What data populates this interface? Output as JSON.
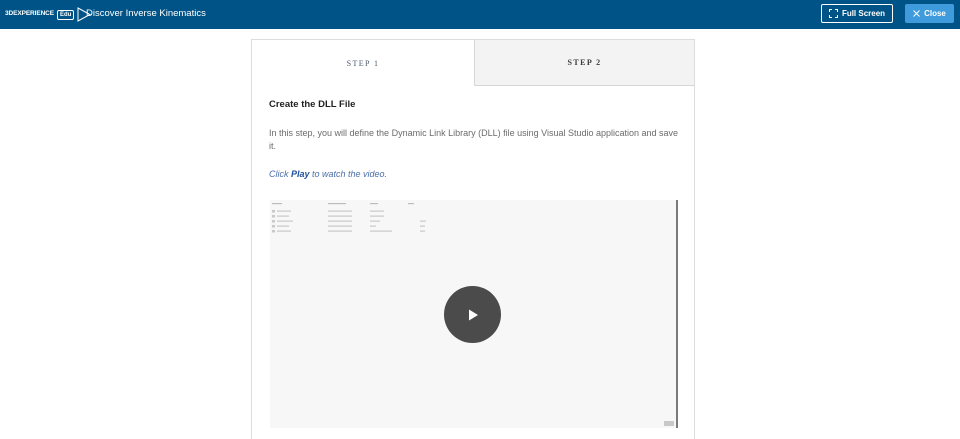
{
  "header": {
    "brand_text": "3DEXPERIENCE",
    "brand_edu": "Edu",
    "title": "Discover Inverse Kinematics",
    "fullscreen_label": "Full Screen",
    "close_label": "Close",
    "colors": {
      "bar": "#005386",
      "close_button": "#3f9bdb"
    }
  },
  "tabs": [
    {
      "label": "STEP 1",
      "active": true
    },
    {
      "label": "STEP 2",
      "active": false
    }
  ],
  "content": {
    "title": "Create the DLL File",
    "description": "In this step, you will define the Dynamic Link Library (DLL)  file using Visual Studio application and save it.",
    "hint_prefix": "Click ",
    "hint_strong": "Play",
    "hint_suffix": " to watch the video."
  },
  "video": {
    "play_icon": "play-icon"
  }
}
